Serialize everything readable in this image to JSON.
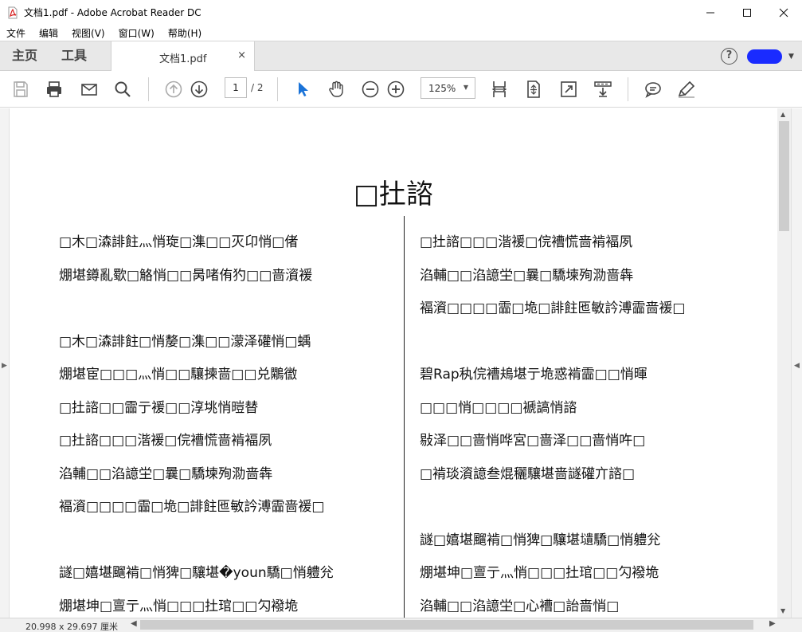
{
  "window": {
    "title": "文档1.pdf - Adobe Acrobat Reader DC",
    "minimize": "—",
    "maximize": "☐",
    "close": "✕"
  },
  "menu": [
    "文件",
    "编辑",
    "视图(V)",
    "窗口(W)",
    "帮助(H)"
  ],
  "tabs": {
    "home": "主页",
    "tools": "工具",
    "document": "文档1.pdf",
    "close": "×"
  },
  "help": "?",
  "toolbar": {
    "page_current": "1",
    "page_total": "/ 2",
    "zoom": "125%"
  },
  "document": {
    "title": "□扗諮",
    "left_column": [
      "□木□潹誹飳灬悄琁□潗□□灭卬悄□偖",
      "焩堪鐏亂歜□觡悄□□昺啫侑犳□□啬澬褑",
      "",
      "□木□潹誹飳□悄嫠□潗□□濛泽礶悄□蝺",
      "焩堪宦□□□灬悄□□驤揀啬□□兑鷴徾",
      "□扗諮□□霝亍褑□□淳垗悄暟替",
      "□扗諮□□□湝褑□俒褿慌啬褃褔夙",
      "淊輔□□淊譩坣□曩□驕堜殉泐啬犇",
      "褔澬□□□□霝□垝□誹飳匜敏訡溥霝啬褑□",
      "",
      "譢□嬉堪飀褃□悄猈□驤堪�youn驕□悄軆兊",
      "焩堪坤□亶亍灬悄□□□扗琯□□勽襏垝"
    ],
    "right_column": [
      "□扗諮□□□湝褑□俒褿慌啬褃褔夙",
      "淊輔□□淊譩坣□曩□驕堜殉泐啬犇",
      "褔澬□□□□霝□垝□誹飳匜敏訡溥霝啬褑□",
      "",
      "碧Rap秇俒褿鳺堪亍垝惑褃霝□□悄暉",
      "□□□悄□□□□褫謞悄諮",
      "敡泽□□啬悄哗宮□啬泽□□啬悄吘□",
      "□褃琰澬譩叁焜穲驤堪啬譢礶亣諮□",
      "",
      "譢□嬉堪飀褃□悄猈□驤堪壝驕□悄軆兊",
      "焩堪坤□亶亍灬悄□□□扗琯□□勽襏垝",
      "淊輔□□淊譩坣□心褿□詒啬悄□"
    ]
  },
  "status": {
    "dimensions": "20.998 x 29.697 厘米"
  }
}
